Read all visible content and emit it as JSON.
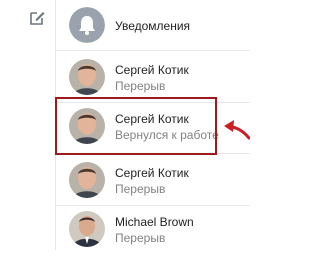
{
  "sidebar": {
    "compose_icon": "compose-icon"
  },
  "notifications": {
    "label": "Уведомления",
    "icon": "bell-icon",
    "icon_bg": "#99a2ad"
  },
  "conversations": [
    {
      "name": "Сергей Котик",
      "status": "Перерыв",
      "avatar": "person-photo"
    },
    {
      "name": "Сергей Котик",
      "status": "Вернулся к работе",
      "avatar": "person-photo",
      "highlighted": true
    },
    {
      "name": "Сергей Котик",
      "status": "Перерыв",
      "avatar": "person-photo"
    },
    {
      "name": "Michael Brown",
      "status": "Перерыв",
      "avatar": "person-photo-suit"
    }
  ],
  "colors": {
    "highlight_border": "#9c1b1f",
    "arrow": "#cc1f24",
    "muted_text": "#828282"
  }
}
